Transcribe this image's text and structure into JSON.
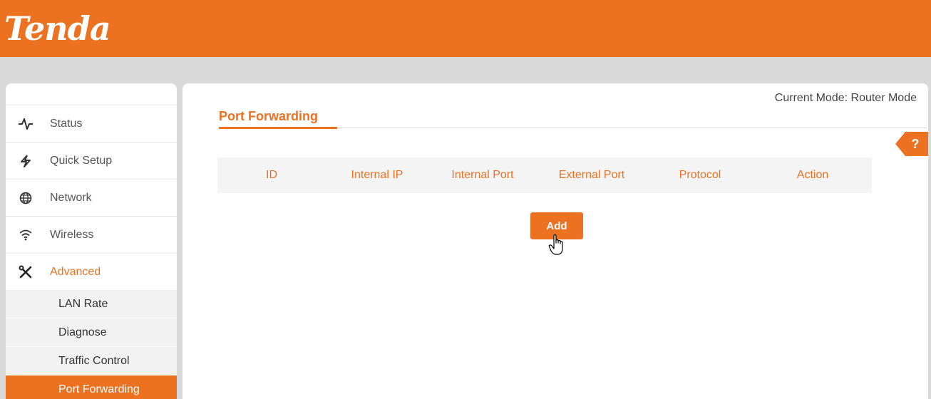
{
  "brand": {
    "logo_text": "Tenda",
    "accent_color": "#ec7120"
  },
  "header": {
    "current_mode": "Current Mode: Router Mode"
  },
  "sidebar": {
    "items": [
      {
        "label": "Status",
        "icon": "pulse-icon"
      },
      {
        "label": "Quick Setup",
        "icon": "lightning-icon"
      },
      {
        "label": "Network",
        "icon": "globe-icon"
      },
      {
        "label": "Wireless",
        "icon": "wifi-icon"
      },
      {
        "label": "Advanced",
        "icon": "tools-icon",
        "active": true
      }
    ],
    "submenu": [
      {
        "label": "LAN Rate"
      },
      {
        "label": "Diagnose"
      },
      {
        "label": "Traffic Control"
      },
      {
        "label": "Port Forwarding",
        "active": true
      }
    ]
  },
  "main": {
    "title": "Port Forwarding",
    "help_label": "?",
    "table": {
      "columns": [
        "ID",
        "Internal IP",
        "Internal Port",
        "External Port",
        "Protocol",
        "Action"
      ],
      "rows": []
    },
    "add_button_label": "Add"
  }
}
